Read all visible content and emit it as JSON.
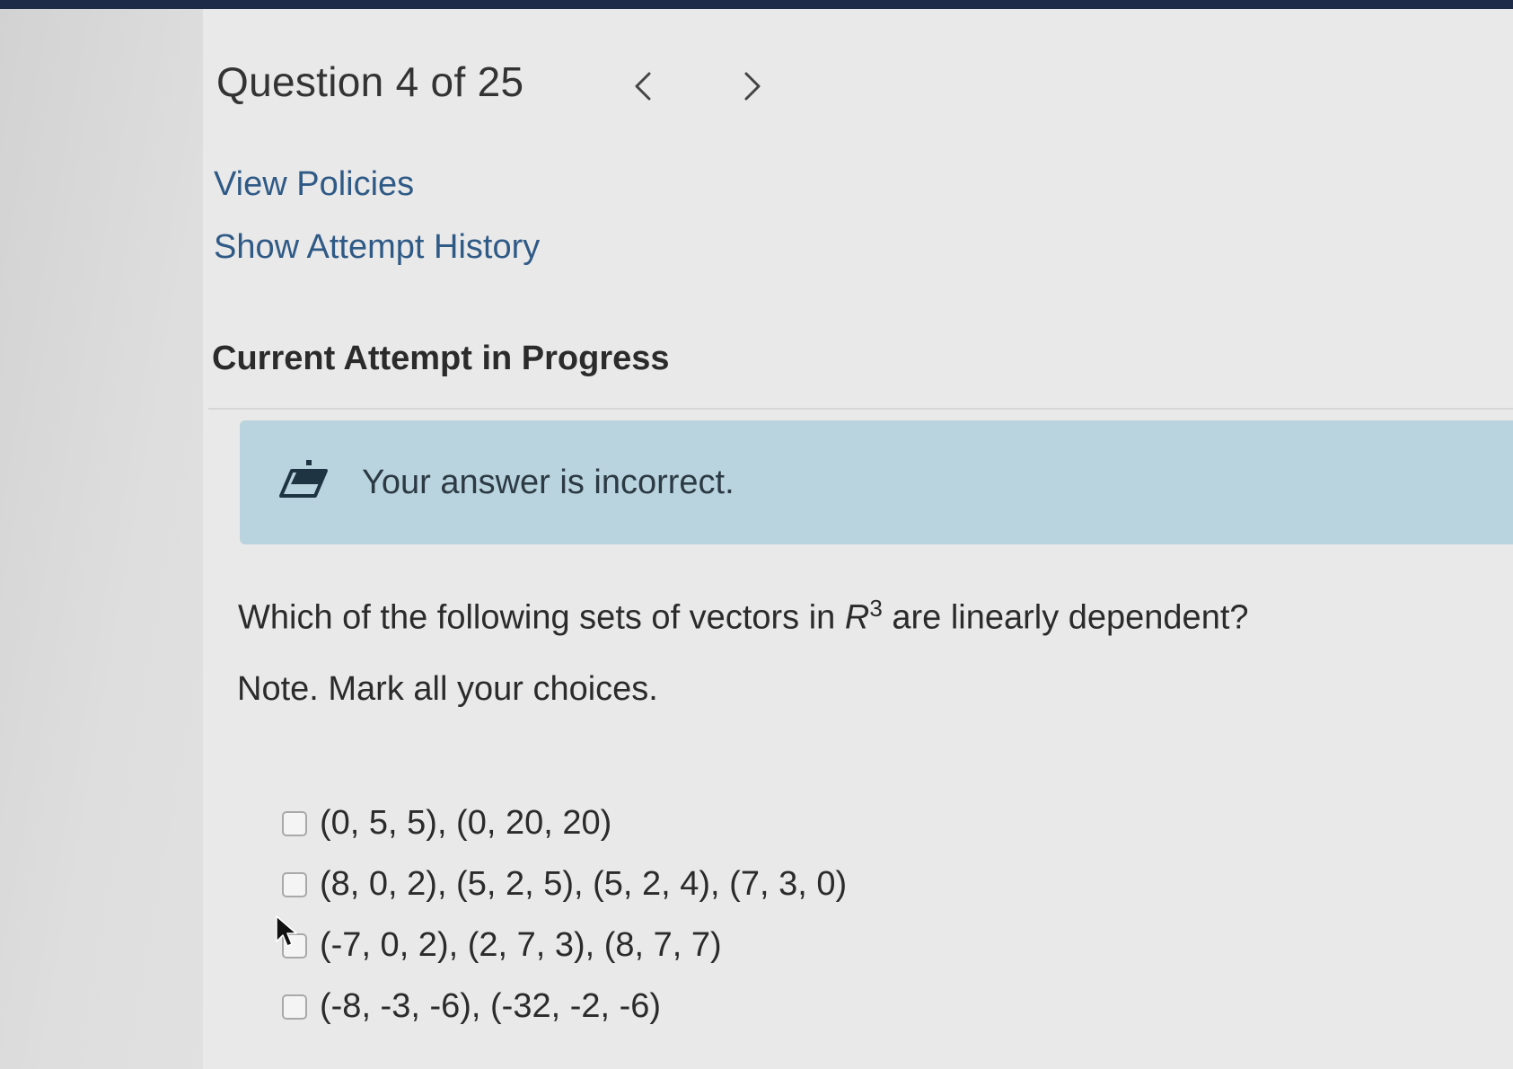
{
  "header": {
    "question_counter": "Question 4 of 25",
    "prev_glyph": "<",
    "next_glyph": ">"
  },
  "links": {
    "view_policies": "View Policies",
    "show_attempt_history": "Show Attempt History"
  },
  "attempt": {
    "heading": "Current Attempt in Progress"
  },
  "feedback": {
    "icon": "eraser-icon",
    "message": "Your answer is incorrect."
  },
  "question": {
    "prefix": "Which of the following sets of vectors in ",
    "space_symbol": "R",
    "space_exponent": "3",
    "suffix": " are linearly dependent?",
    "note": "Note. Mark all your choices."
  },
  "choices": [
    {
      "label": "(0, 5, 5), (0, 20, 20)",
      "checked": false
    },
    {
      "label": "(8, 0, 2), (5, 2, 5), (5, 2, 4), (7, 3, 0)",
      "checked": false
    },
    {
      "label": "(-7, 0, 2), (2, 7, 3), (8, 7, 7)",
      "checked": false
    },
    {
      "label": "(-8, -3, -6), (-32, -2, -6)",
      "checked": false
    }
  ],
  "colors": {
    "top_bar": "#1d2a48",
    "link": "#2f5a86",
    "feedback_bg": "#b9d4de"
  }
}
